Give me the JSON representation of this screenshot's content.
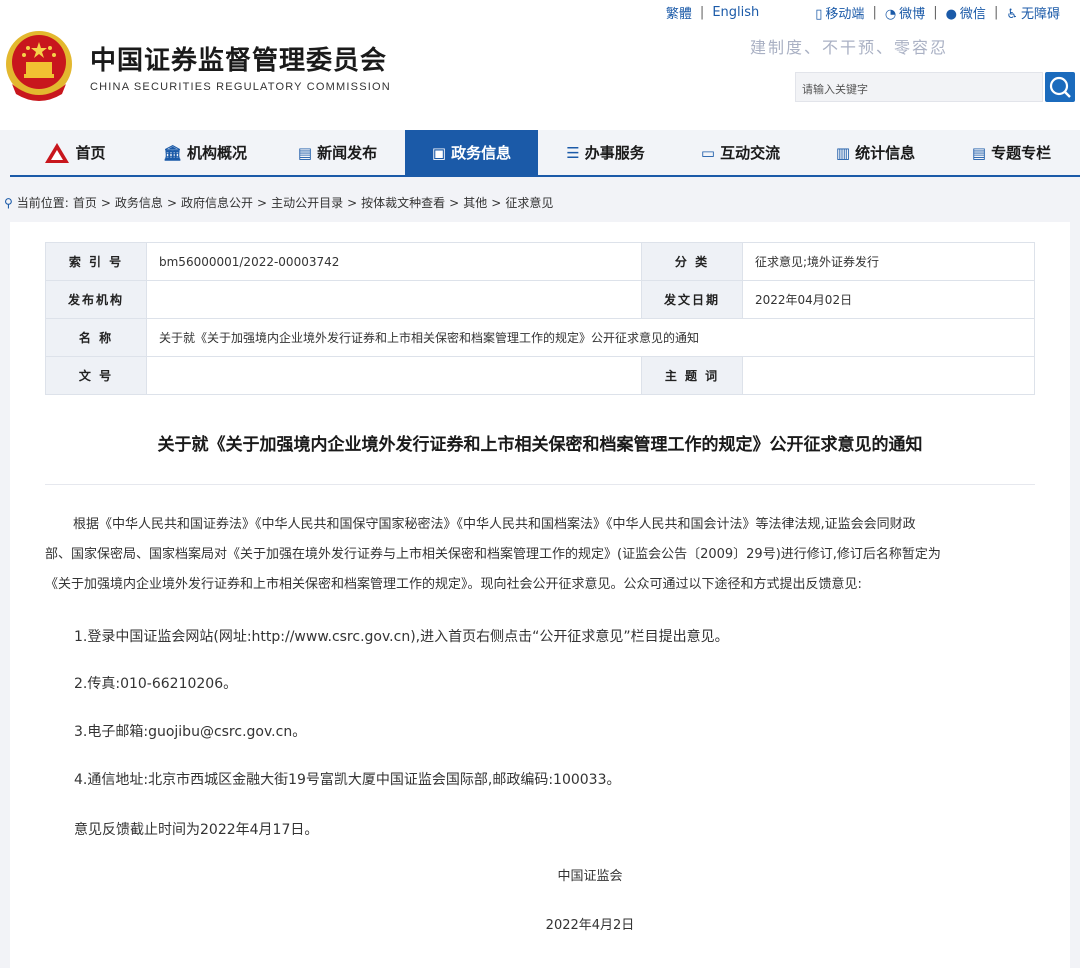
{
  "header": {
    "title_zh": "中国证券监督管理委员会",
    "title_en": "CHINA SECURITIES REGULATORY COMMISSION",
    "slogan": "建制度、不干预、零容忍",
    "search_placeholder": "请输入关键字",
    "top_links": {
      "traditional": "繁體",
      "english": "English",
      "mobile": "移动端",
      "weibo": "微博",
      "wechat": "微信",
      "accessibility": "无障碍"
    }
  },
  "nav": {
    "items": [
      {
        "label": "首页",
        "icon": "csrc-logo-icon"
      },
      {
        "label": "机构概况",
        "icon": "building-icon"
      },
      {
        "label": "新闻发布",
        "icon": "news-icon"
      },
      {
        "label": "政务信息",
        "icon": "monitor-icon"
      },
      {
        "label": "办事服务",
        "icon": "service-icon"
      },
      {
        "label": "互动交流",
        "icon": "chat-icon"
      },
      {
        "label": "统计信息",
        "icon": "bar-chart-icon"
      },
      {
        "label": "专题专栏",
        "icon": "column-icon"
      }
    ],
    "active_index": 3
  },
  "breadcrumb": {
    "prefix": "当前位置:",
    "path": [
      "首页",
      "政务信息",
      "政府信息公开",
      "主动公开目录",
      "按体裁文种查看",
      "其他",
      "征求意见"
    ]
  },
  "meta": {
    "index_label": "索 引 号",
    "index_value": "bm56000001/2022-00003742",
    "category_label": "分 类",
    "category_value": "征求意见;境外证券发行",
    "publisher_label": "发布机构",
    "publisher_value": "",
    "date_label": "发文日期",
    "date_value": "2022年04月02日",
    "name_label": "名 称",
    "name_value": "关于就《关于加强境内企业境外发行证券和上市相关保密和档案管理工作的规定》公开征求意见的通知",
    "docno_label": "文 号",
    "docno_value": "",
    "topic_label": "主 题 词",
    "topic_value": ""
  },
  "article": {
    "title": "关于就《关于加强境内企业境外发行证券和上市相关保密和档案管理工作的规定》公开征求意见的通知",
    "intro_line1": "根据《中华人民共和国证券法》《中华人民共和国保守国家秘密法》《中华人民共和国档案法》《中华人民共和国会计法》等法律法规,证监会会同财政",
    "intro_line2": "部、国家保密局、国家档案局对《关于加强在境外发行证券与上市相关保密和档案管理工作的规定》(证监会公告〔2009〕29号)进行修订,修订后名称暂定为",
    "intro_line3": "《关于加强境内企业境外发行证券和上市相关保密和档案管理工作的规定》。现向社会公开征求意见。公众可通过以下途径和方式提出反馈意见:",
    "item1": "1.登录中国证监会网站(网址:http://www.csrc.gov.cn),进入首页右侧点击“公开征求意见”栏目提出意见。",
    "item2": "2.传真:010-66210206。",
    "item3": "3.电子邮箱:guojibu@csrc.gov.cn。",
    "item4": "4.通信地址:北京市西城区金融大街19号富凯大厦中国证监会国际部,邮政编码:100033。",
    "deadline": "意见反馈截止时间为2022年4月17日。",
    "signature": "中国证监会",
    "sign_date": "2022年4月2日"
  },
  "colors": {
    "brand_blue": "#1b5aa8",
    "emblem_red": "#c8161d",
    "emblem_gold": "#f1c232"
  }
}
